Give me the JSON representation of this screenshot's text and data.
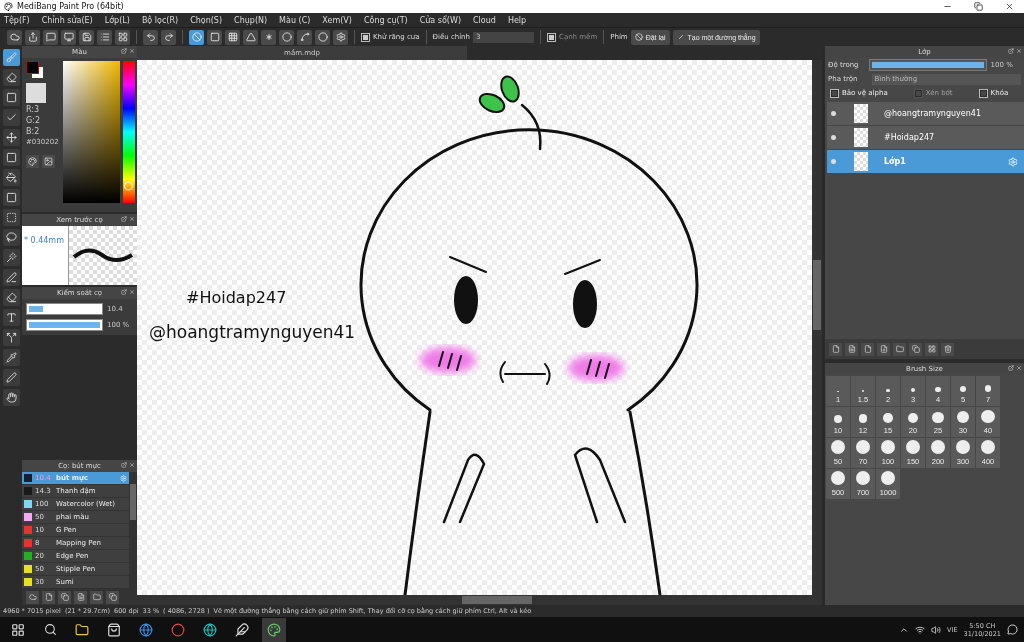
{
  "window": {
    "title": "MediBang Paint Pro (64bit)"
  },
  "menu": [
    "Tệp(F)",
    "Chỉnh sửa(E)",
    "Lớp(L)",
    "Bộ lọc(R)",
    "Chọn(S)",
    "Chụp(N)",
    "Màu (C)",
    "Xem(V)",
    "Công cụ(T)",
    "Cửa sổ(W)",
    "Cloud",
    "Help"
  ],
  "toolbar": {
    "snaps": [
      {
        "selected": true
      },
      {
        "selected": false
      },
      {
        "selected": false
      },
      {
        "selected": false
      },
      {
        "selected": false
      },
      {
        "selected": false
      },
      {
        "selected": false
      },
      {
        "selected": false
      },
      {
        "selected": false
      }
    ],
    "antialias": {
      "label": "Khử răng cưa",
      "checked": true
    },
    "adjust": {
      "label": "Điều chỉnh",
      "value": "3"
    },
    "smooth": {
      "label": "Cạnh mềm",
      "checked": true
    },
    "key_label": "Phím",
    "reset": "Đặt lại",
    "make_line": "Tạo một đường thẳng"
  },
  "tools": [
    {
      "kind": "brush",
      "selected": true
    },
    {
      "kind": "eraser",
      "selected": false
    },
    {
      "kind": "dot",
      "selected": false
    },
    {
      "kind": "check",
      "selected": false
    },
    {
      "kind": "move",
      "selected": false
    },
    {
      "kind": "fill",
      "selected": false
    },
    {
      "kind": "bucket",
      "selected": false
    },
    {
      "kind": "gradient",
      "selected": false
    },
    {
      "kind": "select",
      "selected": false
    },
    {
      "kind": "lasso",
      "selected": false
    },
    {
      "kind": "wand",
      "selected": false
    },
    {
      "kind": "selpen",
      "selected": false
    },
    {
      "kind": "selerase",
      "selected": false
    },
    {
      "kind": "text",
      "selected": false
    },
    {
      "kind": "divide",
      "selected": false
    },
    {
      "kind": "dropper",
      "selected": false
    },
    {
      "kind": "pen",
      "selected": false
    },
    {
      "kind": "hand",
      "selected": false
    }
  ],
  "color_panel": {
    "title": "Màu",
    "r": "R:3",
    "g": "G:2",
    "b": "B:2",
    "hex": "#030202",
    "hue": {
      "level": 0.12
    }
  },
  "brush_preview": {
    "title": "Xem trước cọ",
    "size": "* 0.44mm"
  },
  "brush_control": {
    "title": "Kiểm soát cọ",
    "size": {
      "level": 0.2,
      "reading": "10.4"
    },
    "opacity": {
      "level": 1,
      "reading": "100 %"
    }
  },
  "brush_list": {
    "title": "Cọ: bút mực",
    "items": [
      {
        "size": "10.4",
        "name": "bút mực",
        "color": "#1c1c2c",
        "selected": true
      },
      {
        "size": "14.3",
        "name": "Thanh đậm",
        "color": "#1a1a1a",
        "selected": false
      },
      {
        "size": "100",
        "name": "Watercolor (Wet)",
        "color": "#80d4f6",
        "selected": false
      },
      {
        "size": "50",
        "name": "phai màu",
        "color": "#f6a8f0",
        "selected": false
      },
      {
        "size": "10",
        "name": "G Pen",
        "color": "#e83232",
        "selected": false
      },
      {
        "size": "8",
        "name": "Mapping Pen",
        "color": "#e83232",
        "selected": false
      },
      {
        "size": "20",
        "name": "Edge Pen",
        "color": "#22b022",
        "selected": false
      },
      {
        "size": "50",
        "name": "Stipple Pen",
        "color": "#e8e020",
        "selected": false
      },
      {
        "size": "30",
        "name": "Sumi",
        "color": "#e8e020",
        "selected": false
      }
    ]
  },
  "document": {
    "tab": "mầm.mdp",
    "texts": [
      "#Hoidap247",
      "@hoangtramynguyen41"
    ]
  },
  "layers_panel": {
    "title": "Lớp",
    "opacity": {
      "label": "Độ trong",
      "level": 1,
      "reading": "100 %"
    },
    "blend": {
      "label": "Pha trộn",
      "value": "Bình thường"
    },
    "options": [
      {
        "label": "Bảo vệ alpha",
        "checked": false,
        "disabled": false
      },
      {
        "label": "Xén bớt",
        "checked": false,
        "disabled": true
      },
      {
        "label": "Khóa",
        "checked": false,
        "disabled": false
      }
    ],
    "layers": [
      {
        "name": "@hoangtramynguyen41",
        "selected": false
      },
      {
        "name": "#Hoidap247",
        "selected": false
      },
      {
        "name": "Lớp1",
        "selected": true
      }
    ]
  },
  "brush_size": {
    "title": "Brush Size",
    "sizes": [
      "1",
      "1.5",
      "2",
      "3",
      "4",
      "5",
      "7",
      "10",
      "12",
      "15",
      "20",
      "25",
      "30",
      "40",
      "50",
      "70",
      "100",
      "150",
      "200",
      "300",
      "400",
      "500",
      "700",
      "1000"
    ]
  },
  "status_bar": {
    "size": "4960 * 7015 pixel",
    "paper": "(21 * 29.7cm)",
    "dpi": "600 dpi",
    "zoom": "33 %",
    "cursor": "( 4086, 2728 )",
    "hint": "Vẽ một đường thẳng bằng cách giữ phím Shift, Thay đổi cỡ cọ bằng cách giữ phím Ctrl, Alt và kéo"
  },
  "taskbar": {
    "lang": "VIE",
    "time": "5:50 CH",
    "date": "31/10/2021"
  }
}
